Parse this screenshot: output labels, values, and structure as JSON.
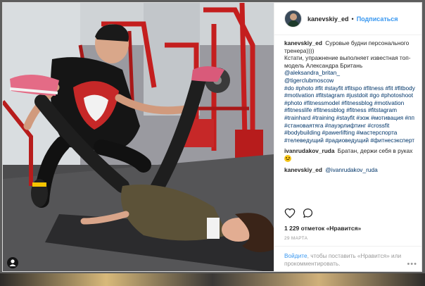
{
  "header": {
    "username": "kanevskiy_ed",
    "separator": "•",
    "follow_label": "Подписаться"
  },
  "comments": [
    {
      "user": "kanevskiy_ed",
      "text": "Суровые будни персонального тренера))))\nКстати, упражнение выполняет известная топ-модель Александра Британь",
      "mentions": [
        "@aleksandra_britan_",
        "@tigerclubmoscow"
      ],
      "hashtags": "#do #photo #fit #stayfit #fitspo #fitness #fit #fitbody #motivation #fitstagram #justdoit #go #photoshoot #photo #fitnessmodel #fitnessblog #motivation #fitnesslife #fitnessblog #fitness #fitstagram #trainhard #training #stayfit #зож #мотивация #пп #становаятяга #пауэрлифтинг #crossfit #bodybuilding #pawerlifting #мастерспорта #телеведущий #радиоведущий #фитнесэксперт"
    },
    {
      "user": "ivanrudakov_ruda",
      "text": "Братан, держи себя в руках",
      "emoji": "smiling-face-emoji"
    },
    {
      "user": "kanevskiy_ed",
      "mention": "@ivanrudakov_ruda"
    }
  ],
  "actions": {
    "like_icon": "heart-icon",
    "comment_icon": "comment-icon"
  },
  "likes": {
    "count_text": "1 229 отметок",
    "separator": "«",
    "like_link": "Нравится»"
  },
  "date": "29 МАРТА",
  "footer": {
    "login_link": "Войдите",
    "text": ", чтобы поставить «Нравится» или прокомментировать."
  },
  "more_label": "•••",
  "colors": {
    "accent": "#3897f0",
    "text": "#262626",
    "muted": "#999999",
    "link": "#003569"
  }
}
